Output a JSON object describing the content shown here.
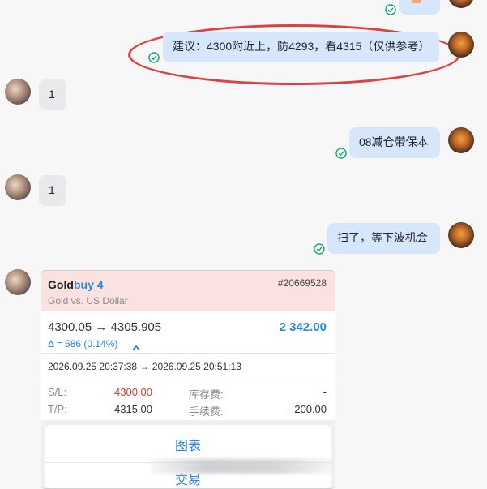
{
  "messages": {
    "top_read_status": "已读",
    "msg1": {
      "text": "建议：4300附近上，防4293，看4315（仅供参考）"
    },
    "reply1": {
      "text": "1"
    },
    "msg2": {
      "text": "08减仓带保本"
    },
    "reply2": {
      "text": "1"
    },
    "msg3": {
      "text": "扫了，等下波机会"
    }
  },
  "trade_card": {
    "symbol": "Gold",
    "side": "buy 4",
    "ticket": "#20669528",
    "description": "Gold vs. US Dollar",
    "price_range": "4300.05 → 4305.905",
    "profit": "2 342.00",
    "delta": "Δ = 586 (0.14%)",
    "time_range": "2026.09.25 20:37:38 → 2026.09.25 20:51:13",
    "sl_label": "S/L:",
    "sl_value": "4300.00",
    "swap_label": "库存费:",
    "swap_value": "-",
    "tp_label": "T/P:",
    "tp_value": "4315.00",
    "fee_label": "手续费:",
    "fee_value": "-200.00",
    "action_chart": "图表",
    "action_trade": "交易"
  },
  "colors": {
    "outgoing_bubble": "#d6e6fb",
    "incoming_bubble": "#e9e9ec",
    "highlight_oval": "#e0413f",
    "profit_blue": "#2d86d8",
    "sl_red": "#c9423a",
    "card_header": "#fce1e1",
    "read_check": "#1aa37a"
  }
}
